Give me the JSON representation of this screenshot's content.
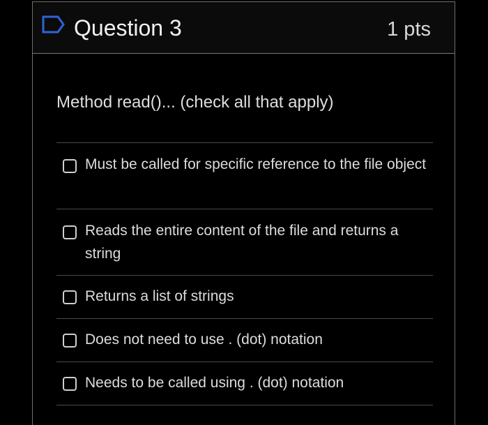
{
  "question": {
    "title": "Question 3",
    "points": "1 pts",
    "flag_icon": "flag-outline-icon",
    "prompt": "Method read()... (check all that apply)"
  },
  "answers": [
    {
      "label": "Must be called for specific reference to the file object",
      "checked": false
    },
    {
      "label": "Reads the entire content of the file and returns a string",
      "checked": false
    },
    {
      "label": "Returns a list of strings",
      "checked": false
    },
    {
      "label": "Does not need to use . (dot) notation",
      "checked": false
    },
    {
      "label": "Needs to be called using . (dot) notation",
      "checked": false
    }
  ],
  "colors": {
    "background": "#000000",
    "header_background": "#0b0b0b",
    "flag_icon": "#2f63d8",
    "text": "#dcdcdc",
    "divider": "#4a4a4a"
  }
}
